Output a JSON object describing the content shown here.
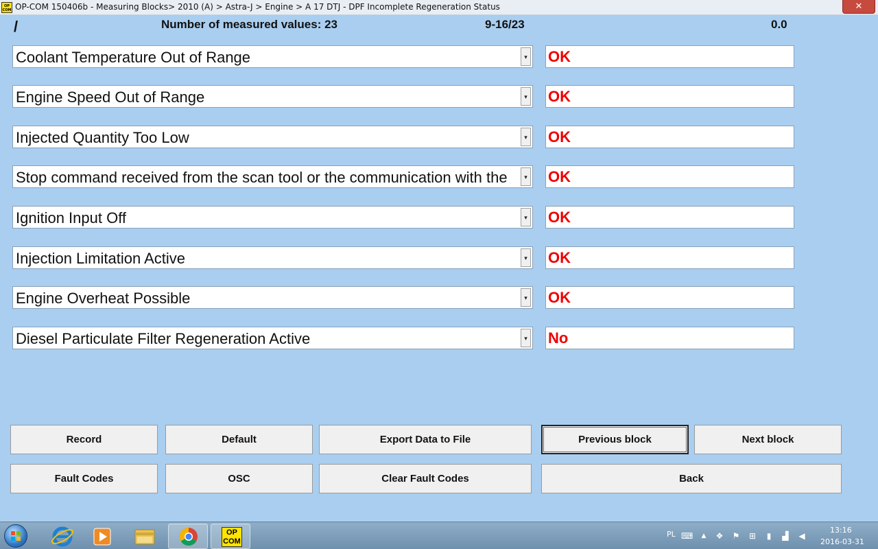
{
  "window": {
    "title": "OP-COM 150406b - Measuring Blocks> 2010 (A) > Astra-J > Engine > A 17 DTJ - DPF Incomplete Regeneration Status",
    "logo": [
      "OP",
      "COM"
    ],
    "close_glyph": "✕"
  },
  "header": {
    "slash": "/",
    "count_label": "Number of measured values: 23",
    "range": "9-16/23",
    "value": "0.0"
  },
  "rows": [
    {
      "label": "Coolant Temperature Out of Range",
      "value": "OK"
    },
    {
      "label": "Engine Speed Out of Range",
      "value": "OK"
    },
    {
      "label": "Injected Quantity Too Low",
      "value": "OK"
    },
    {
      "label": "Stop command received from the scan tool or the communication with the",
      "value": "OK"
    },
    {
      "label": "Ignition Input Off",
      "value": "OK"
    },
    {
      "label": "Injection Limitation Active",
      "value": "OK"
    },
    {
      "label": "Engine Overheat Possible",
      "value": "OK"
    },
    {
      "label": "Diesel Particulate Filter Regeneration Active",
      "value": "No"
    }
  ],
  "dropdown_glyph": "▾",
  "buttons": {
    "record": "Record",
    "default": "Default",
    "export": "Export Data to File",
    "previous": "Previous block",
    "next": "Next block",
    "fault_codes": "Fault Codes",
    "osc": "OSC",
    "clear_fault_codes": "Clear Fault Codes",
    "back": "Back"
  },
  "taskbar": {
    "opcom_label": [
      "OP",
      "COM"
    ],
    "language": "PL",
    "time": "13:16",
    "date": "2016-03-31",
    "icons": [
      "start-orb",
      "internet-explorer-icon",
      "media-player-icon",
      "file-explorer-icon",
      "chrome-icon",
      "opcom-taskbar-icon"
    ]
  },
  "colors": {
    "background": "#a9cef0",
    "value_text": "#ee0000"
  }
}
